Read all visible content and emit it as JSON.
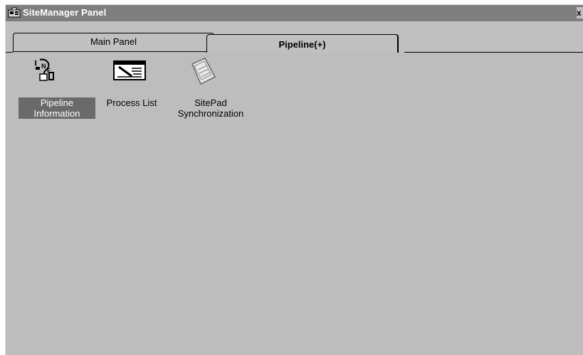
{
  "window": {
    "title": "SiteManager Panel",
    "close_glyph": "x"
  },
  "tabs": [
    {
      "label": "Main Panel",
      "active": false
    },
    {
      "label": "Pipeline(+)",
      "active": true
    }
  ],
  "items": [
    {
      "line1": "Pipeline",
      "line2": "Information",
      "icon": "info-pipeline-icon",
      "selected": true
    },
    {
      "line1": "Process List",
      "line2": "",
      "icon": "process-list-icon",
      "selected": false
    },
    {
      "line1": "SitePad",
      "line2": "Synchronization",
      "icon": "sitepad-sync-icon",
      "selected": false
    }
  ],
  "colors": {
    "titlebar": "#7e7e7e",
    "panel": "#c0c0c0",
    "selected_label": "#6a6a6a"
  }
}
